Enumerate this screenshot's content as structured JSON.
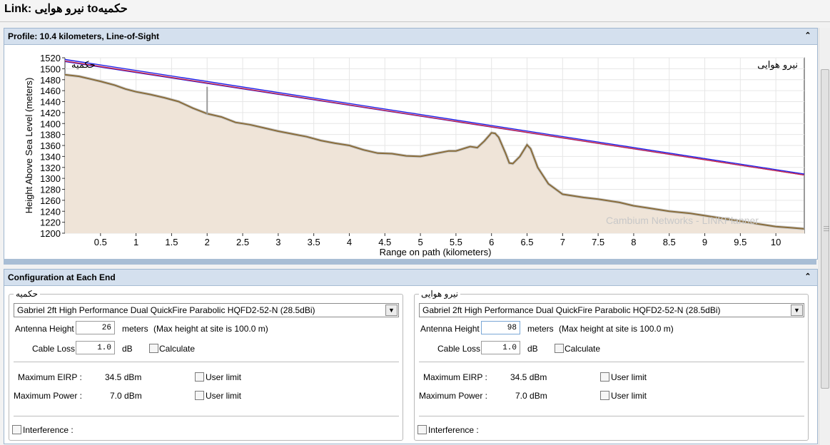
{
  "title": "Link: نیرو هوایی toحکمیه",
  "profile": {
    "header": "Profile: 10.4 kilometers, Line-of-Sight",
    "collapse_icon": "double-chevron-up-icon"
  },
  "chart_data": {
    "type": "area",
    "ylabel": "Height Above Sea Level (meters)",
    "xlabel": "Range on path (kilometers)",
    "ylim": [
      1200,
      1520
    ],
    "xlim": [
      0,
      10.4
    ],
    "yticks": [
      "1200",
      "1220",
      "1240",
      "1260",
      "1280",
      "1300",
      "1320",
      "1340",
      "1360",
      "1380",
      "1400",
      "1420",
      "1440",
      "1460",
      "1480",
      "1500",
      "1520"
    ],
    "xticks": [
      "0.5",
      "1",
      "1.5",
      "2",
      "2.5",
      "3",
      "3.5",
      "4",
      "4.5",
      "5",
      "5.5",
      "6",
      "6.5",
      "7",
      "7.5",
      "8",
      "8.5",
      "9",
      "9.5",
      "10"
    ],
    "left_site": "حکمیه",
    "right_site": "نیرو هوایی",
    "watermark": "Cambium Networks - LINKPlanner",
    "grid": true,
    "colors": {
      "terrain_fill": "#efe4d8",
      "terrain_line": "#8a6d3b",
      "fresnel": "#1a1ae6",
      "fresnel_fill": "#b5b5ee",
      "los": "#d2203a",
      "antenna": "#9a9a9a"
    },
    "terrain": [
      [
        0,
        1489
      ],
      [
        0.2,
        1486
      ],
      [
        0.5,
        1477
      ],
      [
        0.7,
        1470
      ],
      [
        0.85,
        1463
      ],
      [
        1.0,
        1458
      ],
      [
        1.2,
        1453
      ],
      [
        1.4,
        1447
      ],
      [
        1.6,
        1440
      ],
      [
        1.8,
        1428
      ],
      [
        2.0,
        1418
      ],
      [
        2.2,
        1412
      ],
      [
        2.4,
        1402
      ],
      [
        2.6,
        1398
      ],
      [
        2.8,
        1392
      ],
      [
        3.0,
        1386
      ],
      [
        3.2,
        1381
      ],
      [
        3.4,
        1376
      ],
      [
        3.6,
        1369
      ],
      [
        3.8,
        1364
      ],
      [
        4.0,
        1360
      ],
      [
        4.2,
        1352
      ],
      [
        4.4,
        1346
      ],
      [
        4.6,
        1345
      ],
      [
        4.8,
        1341
      ],
      [
        5.0,
        1340
      ],
      [
        5.2,
        1345
      ],
      [
        5.4,
        1350
      ],
      [
        5.5,
        1350
      ],
      [
        5.7,
        1358
      ],
      [
        5.8,
        1356
      ],
      [
        5.9,
        1368
      ],
      [
        6.0,
        1383
      ],
      [
        6.05,
        1382
      ],
      [
        6.1,
        1375
      ],
      [
        6.2,
        1345
      ],
      [
        6.25,
        1328
      ],
      [
        6.3,
        1327
      ],
      [
        6.4,
        1340
      ],
      [
        6.5,
        1361
      ],
      [
        6.55,
        1354
      ],
      [
        6.65,
        1320
      ],
      [
        6.8,
        1290
      ],
      [
        7.0,
        1271
      ],
      [
        7.3,
        1265
      ],
      [
        7.5,
        1262
      ],
      [
        7.8,
        1256
      ],
      [
        8.0,
        1250
      ],
      [
        8.2,
        1246
      ],
      [
        8.5,
        1240
      ],
      [
        8.8,
        1236
      ],
      [
        9.0,
        1232
      ],
      [
        9.2,
        1228
      ],
      [
        9.5,
        1222
      ],
      [
        9.8,
        1216
      ],
      [
        10.0,
        1212
      ],
      [
        10.2,
        1210
      ],
      [
        10.4,
        1208
      ]
    ],
    "los_line": [
      [
        0,
        1514
      ],
      [
        10.4,
        1306
      ]
    ],
    "fresnel_upper": [
      [
        0,
        1517
      ],
      [
        10.4,
        1308
      ]
    ],
    "fresnel_lower": [
      [
        0,
        1513
      ],
      [
        10.4,
        1306
      ]
    ],
    "left_antenna_height_m": 26,
    "right_antenna_height_m": 98
  },
  "config": {
    "header": "Configuration at Each End",
    "collapse_icon": "double-chevron-up-icon",
    "ends": [
      {
        "name": "حکمیه",
        "antenna": "Gabriel 2ft High Performance Dual QuickFire Parabolic HQFD2-52-N (28.5dBi)",
        "antenna_height_label": "Antenna Height :",
        "antenna_height": "26",
        "meters_label": "meters",
        "max_height_note": "(Max height at site is 100.0 m)",
        "cable_loss_label": "Cable Loss :",
        "cable_loss": "1.0",
        "db_label": "dB",
        "calculate_label": "Calculate",
        "max_eirp_label": "Maximum EIRP :",
        "max_eirp": "34.5 dBm",
        "max_power_label": "Maximum Power :",
        "max_power": "7.0 dBm",
        "user_limit_label": "User limit",
        "interference_label": "Interference :"
      },
      {
        "name": "نیرو هوایی",
        "antenna": "Gabriel 2ft High Performance Dual QuickFire Parabolic HQFD2-52-N (28.5dBi)",
        "antenna_height_label": "Antenna Height :",
        "antenna_height": "98",
        "meters_label": "meters",
        "max_height_note": "(Max height at site is 100.0 m)",
        "cable_loss_label": "Cable Loss :",
        "cable_loss": "1.0",
        "db_label": "dB",
        "calculate_label": "Calculate",
        "max_eirp_label": "Maximum EIRP :",
        "max_eirp": "34.5 dBm",
        "max_power_label": "Maximum Power :",
        "max_power": "7.0 dBm",
        "user_limit_label": "User limit",
        "interference_label": "Interference :"
      }
    ]
  }
}
